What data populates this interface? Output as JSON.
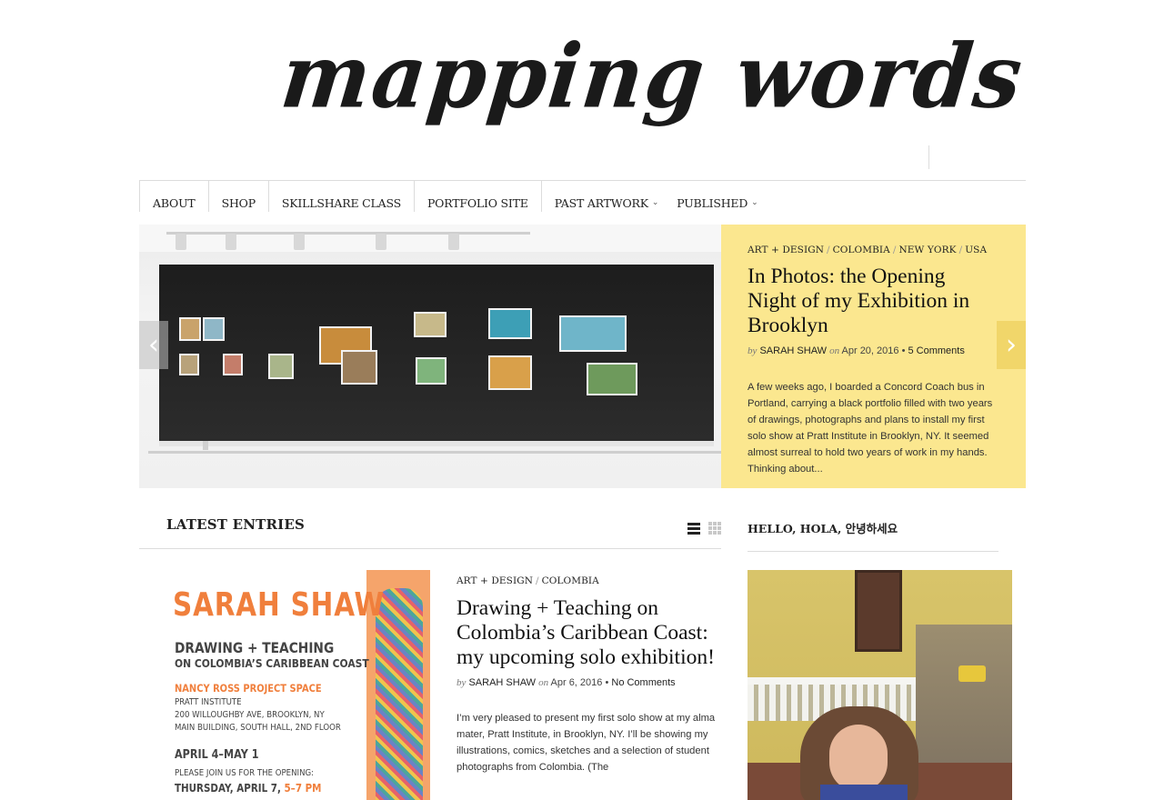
{
  "site": {
    "logo_text": "mapping words"
  },
  "nav": {
    "items": [
      {
        "label": "About",
        "dropdown": false
      },
      {
        "label": "Shop",
        "dropdown": false
      },
      {
        "label": "Skillshare Class",
        "dropdown": false
      },
      {
        "label": "Portfolio Site",
        "dropdown": false
      },
      {
        "label": "Past Artwork",
        "dropdown": true
      },
      {
        "label": "Published",
        "dropdown": true
      }
    ],
    "chevron_icon": "chevron-down-icon"
  },
  "slider": {
    "categories": [
      "Art + Design",
      "Colombia",
      "New York",
      "USA"
    ],
    "separator": "/",
    "title": "In Photos: the Opening Night of my Exhibition in Brooklyn",
    "by_label": "by",
    "author": "SARAH SHAW",
    "on_label": "on",
    "date": "Apr 20, 2016",
    "dot": "•",
    "comments": "5 Comments",
    "excerpt": "A few weeks ago, I boarded a Concord Coach bus in Portland, carrying a black portfolio filled with two years of drawings, photographs and plans to install my first solo show at Pratt Institute in Brooklyn, NY. It seemed almost surreal to hold two years of work in my hands. Thinking about...",
    "prev_icon": "‹",
    "next_icon": "›",
    "panel_color": "#fbe78f"
  },
  "latest": {
    "title": "Latest Entries",
    "views": [
      "list-view-icon",
      "grid-view-icon"
    ]
  },
  "entry": {
    "categories": [
      "Art + Design",
      "Colombia"
    ],
    "separator": "/",
    "title": "Drawing + Teaching on Colombia’s Caribbean Coast: my upcoming solo exhibition!",
    "by_label": "by",
    "author": "SARAH SHAW",
    "on_label": "on",
    "date": "Apr 6, 2016",
    "dot": "•",
    "comments": "No Comments",
    "excerpt": "I’m very pleased to present my first solo show at my alma mater, Pratt Institute, in Brooklyn, NY. I’ll be showing my illustrations, comics, sketches and a selection of student photographs from Colombia. (The"
  },
  "poster": {
    "name": "SARAH SHAW",
    "line1": "DRAWING + TEACHING",
    "line2": "ON COLOMBIA’S CARIBBEAN COAST",
    "venue": "NANCY ROSS PROJECT SPACE",
    "addr1": "PRATT INSTITUTE",
    "addr2": "200 WILLOUGHBY AVE, BROOKLYN, NY",
    "addr3": "MAIN BUILDING, SOUTH HALL, 2ND FLOOR",
    "dates": "APRIL 4–MAY 1",
    "invite": "PLEASE JOIN US FOR THE OPENING:",
    "when_day": "THURSDAY, APRIL 7, ",
    "when_time": "5–7 PM"
  },
  "sidebar": {
    "title": "Hello, Hola, 안녕하세요"
  }
}
